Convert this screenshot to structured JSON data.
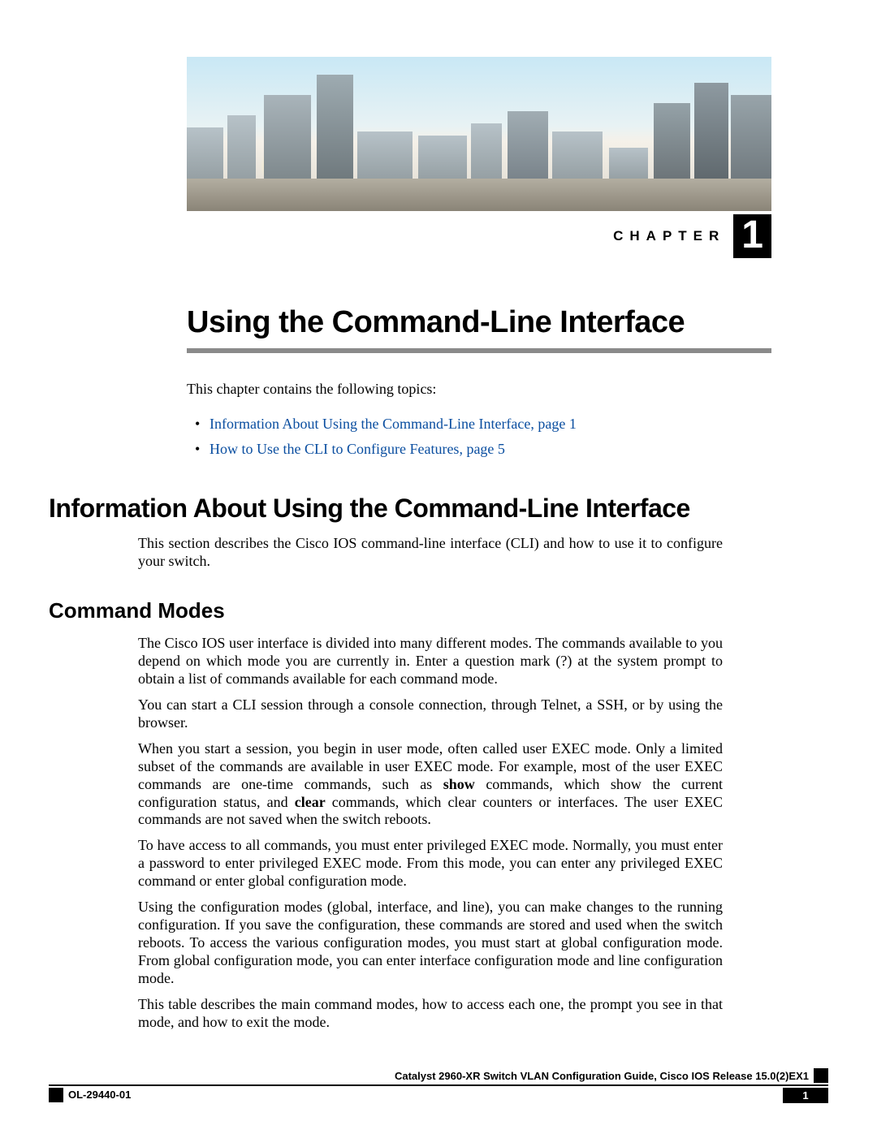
{
  "chapter": {
    "label": "CHAPTER",
    "number": "1",
    "title": "Using the Command-Line Interface"
  },
  "intro": "This chapter contains the following topics:",
  "topics": [
    "Information About Using the Command-Line Interface,  page  1",
    "How to Use the CLI to Configure Features,  page  5"
  ],
  "section1": {
    "heading": "Information About Using the Command-Line Interface",
    "intro": "This section describes the Cisco IOS command-line interface (CLI) and how to use it to configure your switch."
  },
  "section2": {
    "heading": "Command Modes",
    "p1": "The Cisco IOS user interface is divided into many different modes. The commands available to you depend on which mode you are currently in. Enter a question mark (?) at the system prompt to obtain a list of commands available for each command mode.",
    "p2": "You can start a CLI session through a console connection, through Telnet, a SSH, or by using the browser.",
    "p3_pre": "When you start a session, you begin in user mode, often called user EXEC mode. Only a limited subset of the commands are available in user EXEC mode. For example, most of the user EXEC commands are one-time commands, such as ",
    "p3_b1": "show",
    "p3_mid": " commands, which show the current configuration status, and ",
    "p3_b2": "clear",
    "p3_post": " commands, which clear counters or interfaces. The user EXEC commands are not saved when the switch reboots.",
    "p4": "To have access to all commands, you must enter privileged EXEC mode. Normally, you must enter a password to enter privileged EXEC mode. From this mode, you can enter any privileged EXEC command or enter global configuration mode.",
    "p5": "Using the configuration modes (global, interface, and line), you can make changes to the running configuration. If you save the configuration, these commands are stored and used when the switch reboots. To access the various configuration modes, you must start at global configuration mode. From global configuration mode, you can enter interface configuration mode and line configuration mode.",
    "p6": "This table describes the main command modes, how to access each one, the prompt you see in that mode, and how to exit the mode."
  },
  "footer": {
    "doc_title": "Catalyst 2960-XR Switch VLAN Configuration Guide, Cisco IOS Release 15.0(2)EX1",
    "ol": "OL-29440-01",
    "page": "1"
  }
}
